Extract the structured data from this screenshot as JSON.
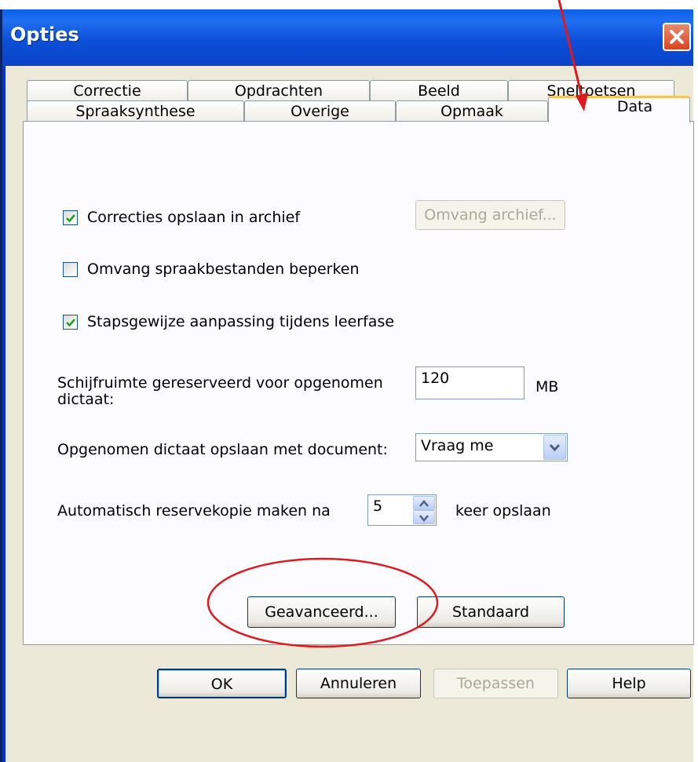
{
  "window": {
    "title": "Opties"
  },
  "tabs_row1": [
    {
      "label": "Correctie"
    },
    {
      "label": "Opdrachten"
    },
    {
      "label": "Beeld"
    },
    {
      "label": "Sneltoetsen"
    }
  ],
  "tabs_row2": [
    {
      "label": "Spraaksynthese"
    },
    {
      "label": "Overige"
    },
    {
      "label": "Opmaak"
    },
    {
      "label": "Data",
      "active": true
    }
  ],
  "options": {
    "correcties": {
      "label": "Correcties opslaan in archief",
      "checked": true
    },
    "omvang_archief_button": "Omvang archief...",
    "omvang_spraak": {
      "label": "Omvang spraakbestanden beperken",
      "checked": false
    },
    "stapsgewijze": {
      "label": "Stapsgewijze aanpassing tijdens leerfase",
      "checked": true
    },
    "schijfruimte": {
      "label_line1": "Schijfruimte gereserveerd voor opgenomen",
      "label_line2": "dictaat:",
      "value": "120",
      "unit": "MB"
    },
    "opslaan_met_document": {
      "label": "Opgenomen dictaat opslaan met document:",
      "value": "Vraag me"
    },
    "reservekopie": {
      "label": "Automatisch reservekopie maken na",
      "value": "5",
      "suffix": "keer opslaan"
    },
    "geavanceerd_button": "Geavanceerd...",
    "standaard_button": "Standaard"
  },
  "footer": {
    "ok": "OK",
    "annuleren": "Annuleren",
    "toepassen": "Toepassen",
    "help": "Help"
  },
  "colors": {
    "titlebar": "#0a4fd8",
    "annotation": "#e0191e",
    "check": "#21a121"
  }
}
